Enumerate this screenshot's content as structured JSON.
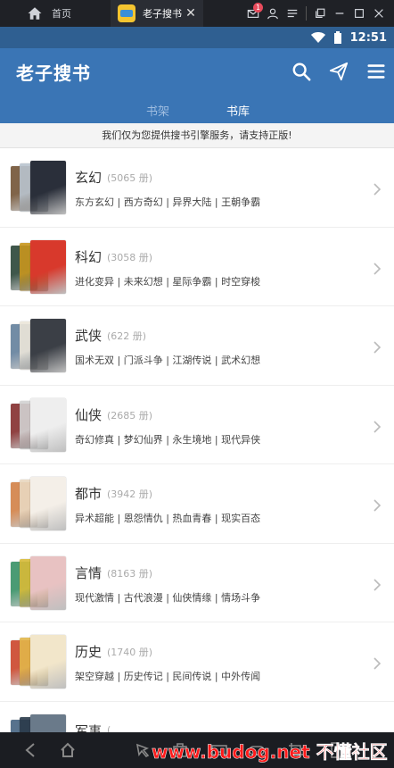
{
  "emulator": {
    "home_label": "首页",
    "tab_label": "老子搜书",
    "close_glyph": "✕",
    "message_badge": "1"
  },
  "status_bar": {
    "time": "12:51"
  },
  "header": {
    "title": "老子搜书",
    "tabs": [
      {
        "label": "书架"
      },
      {
        "label": "书库"
      }
    ],
    "active_tab": "书库"
  },
  "notice": "我们仅为您提供搜书引擎服务，请支持正版!",
  "categories": [
    {
      "name": "玄幻",
      "count": "(5065 册)",
      "tags": "东方玄幻 | 西方奇幻 | 异界大陆 | 王朝争霸",
      "colors": [
        "#6b4a2a",
        "#b9c4cf",
        "#2a2f3a"
      ]
    },
    {
      "name": "科幻",
      "count": "(3058 册)",
      "tags": "进化变异 | 未来幻想 | 星际争霸 | 时空穿梭",
      "colors": [
        "#1e3a2c",
        "#c8961e",
        "#d8392c"
      ]
    },
    {
      "name": "武侠",
      "count": "(622 册)",
      "tags": "国术无双 | 门派斗争 | 江湖传说 | 武术幻想",
      "colors": [
        "#5a7896",
        "#ece6da",
        "#3b3f46"
      ]
    },
    {
      "name": "仙侠",
      "count": "(2685 册)",
      "tags": "奇幻修真 | 梦幻仙界 | 永生境地 | 现代异侠",
      "colors": [
        "#7d2222",
        "#d2d2d2",
        "#eeeeee"
      ]
    },
    {
      "name": "都市",
      "count": "(3942 册)",
      "tags": "异术超能 | 恩怨情仇 | 热血青春 | 现实百态",
      "colors": [
        "#d07a3c",
        "#e9d8c0",
        "#f4efe8"
      ]
    },
    {
      "name": "言情",
      "count": "(8163 册)",
      "tags": "现代激情 | 古代浪漫 | 仙侠情缘 | 情场斗争",
      "colors": [
        "#2c8a5c",
        "#d8bb38",
        "#e8c2c2"
      ]
    },
    {
      "name": "历史",
      "count": "(1740 册)",
      "tags": "架空穿越 | 历史传记 | 民间传说 | 中外传闻",
      "colors": [
        "#c83a1e",
        "#e2b64a",
        "#f2e6ca"
      ]
    },
    {
      "name": "军事",
      "count": "(",
      "tags": "",
      "colors": [
        "#3a5a7a",
        "#2a3a4a",
        "#6a7a8a"
      ]
    }
  ],
  "watermark": "www.budog.net 不懂社区"
}
